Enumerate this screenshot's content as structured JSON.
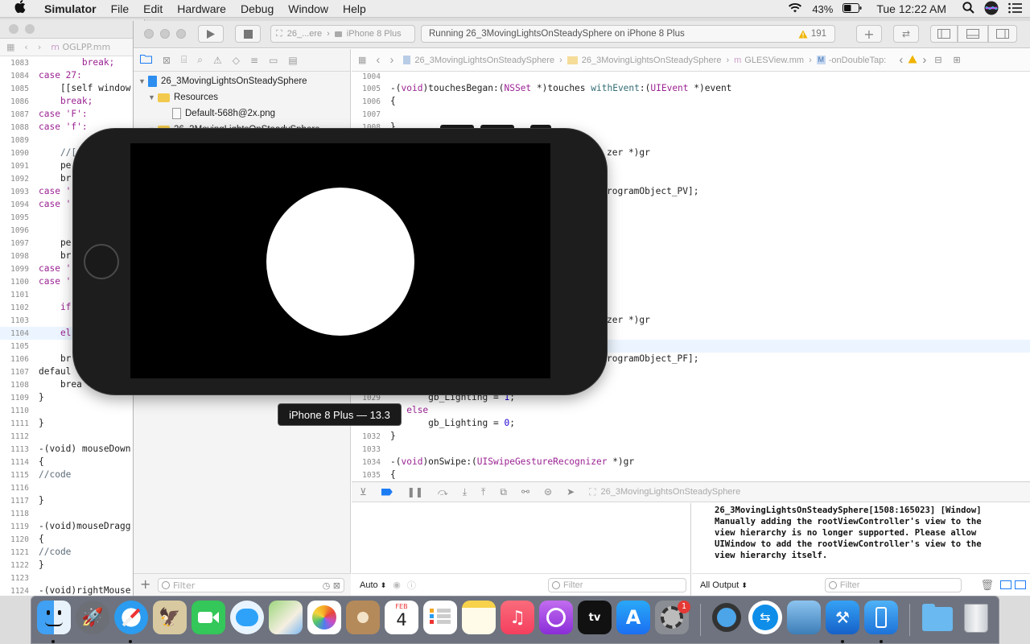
{
  "menubar": {
    "apple": "",
    "items": [
      "Simulator",
      "File",
      "Edit",
      "Hardware",
      "Debug",
      "Window",
      "Help"
    ],
    "battery": "43%",
    "clock": "Tue 12:22 AM"
  },
  "back_window": {
    "tab_title": "OGLPP.mm",
    "lines": [
      {
        "n": "1083",
        "code": "        break;"
      },
      {
        "n": "1084",
        "code": "case 27:"
      },
      {
        "n": "1085",
        "code": "    [[self window"
      },
      {
        "n": "1086",
        "code": "    break;"
      },
      {
        "n": "1087",
        "code": "case 'F':"
      },
      {
        "n": "1088",
        "code": "case 'f':"
      },
      {
        "n": "1089",
        "code": ""
      },
      {
        "n": "1090",
        "code": "    //["
      },
      {
        "n": "1091",
        "code": "    pe"
      },
      {
        "n": "1092",
        "code": "    br"
      },
      {
        "n": "1093",
        "code": "case '"
      },
      {
        "n": "1094",
        "code": "case '"
      },
      {
        "n": "1095",
        "code": ""
      },
      {
        "n": "1096",
        "code": ""
      },
      {
        "n": "1097",
        "code": "    pe"
      },
      {
        "n": "1098",
        "code": "    br"
      },
      {
        "n": "1099",
        "code": "case '"
      },
      {
        "n": "1100",
        "code": "case '"
      },
      {
        "n": "1101",
        "code": ""
      },
      {
        "n": "1102",
        "code": "    if"
      },
      {
        "n": "1103",
        "code": ""
      },
      {
        "n": "1104",
        "code": "    el"
      },
      {
        "n": "1105",
        "code": ""
      },
      {
        "n": "1106",
        "code": "    br"
      },
      {
        "n": "1107",
        "code": "defaul"
      },
      {
        "n": "1108",
        "code": "    brea"
      },
      {
        "n": "1109",
        "code": "}"
      },
      {
        "n": "1110",
        "code": ""
      },
      {
        "n": "1111",
        "code": "}"
      },
      {
        "n": "1112",
        "code": ""
      },
      {
        "n": "1113",
        "code": "-(void) mouseDown"
      },
      {
        "n": "1114",
        "code": "{"
      },
      {
        "n": "1115",
        "code": "//code"
      },
      {
        "n": "1116",
        "code": ""
      },
      {
        "n": "1117",
        "code": "}"
      },
      {
        "n": "1118",
        "code": ""
      },
      {
        "n": "1119",
        "code": "-(void)mouseDragg"
      },
      {
        "n": "1120",
        "code": "{"
      },
      {
        "n": "1121",
        "code": "//code"
      },
      {
        "n": "1122",
        "code": "}"
      },
      {
        "n": "1123",
        "code": ""
      },
      {
        "n": "1124",
        "code": "-(void)rightMouse"
      }
    ]
  },
  "xcode": {
    "scheme": "26_...ere",
    "destination": "iPhone 8 Plus",
    "status": "Running 26_3MovingLightsOnSteadySphere on iPhone 8 Plus",
    "warning_count": "191",
    "navigator": {
      "project": "26_3MovingLightsOnSteadySphere",
      "group_resources": "Resources",
      "file_default": "Default-568h@2x.png",
      "group_partial": "26_3MovingLightsOnSteadySphere",
      "filter_placeholder": "Filter"
    },
    "jumpbar": [
      "26_3MovingLightsOnSteadySphere",
      "26_3MovingLightsOnSteadySphere",
      "GLESView.mm",
      "-onDoubleTap:"
    ],
    "editor": {
      "l1004": "1004",
      "l1005": "1005",
      "c1005a": "-(",
      "c1005b": "void",
      "c1005c": ")touchesBegan:(",
      "c1005d": "NSSet",
      "c1005e": " *)touches ",
      "c1005f": "withEvent",
      "c1005g": ":(",
      "c1005h": "UIEvent",
      "c1005i": " *)event",
      "l1006": "1006",
      "c1006": "{",
      "l1007": "1007",
      "l1008": "1008",
      "c1008": "}",
      "frag1": "zer *)gr",
      "frag2": "rogramObject_PV];",
      "frag3": "zer *)gr",
      "frag4": "rogramObject_PF];",
      "l1029": "1029",
      "c1029a": "gb_Lighting",
      "c1029b": " = ",
      "c1029c": "1",
      "c1029d": ";",
      "l1030": "1030",
      "c1030": "else",
      "l1031": "1031",
      "c1031a": "gb_Lighting",
      "c1031b": " = ",
      "c1031c": "0",
      "c1031d": ";",
      "l1032": "1032",
      "c1032": "}",
      "l1033": "1033",
      "l1034": "1034",
      "c1034a": "-(",
      "c1034b": "void",
      "c1034c": ")onSwipe:(",
      "c1034d": "UISwipeGestureRecognizer",
      "c1034e": " *)gr",
      "l1035": "1035",
      "c1035": "{"
    },
    "debug_target": "26_3MovingLightsOnSteadySphere",
    "console_text": "26_3MovingLightsOnSteadySphere[1508:165023] [Window]\nManually adding the rootViewController's view to the\nview hierarchy is no longer supported. Please allow\nUIWindow to add the rootViewController's view to the\nview hierarchy itself.",
    "auto_label": "Auto",
    "all_output_label": "All Output",
    "filter_placeholder": "Filter"
  },
  "simulator": {
    "tooltip": "iPhone 8 Plus — 13.3"
  },
  "dock": {
    "calendar_month": "FEB",
    "calendar_day": "4",
    "settings_badge": "1",
    "appletv_label": "tv"
  },
  "colors": {
    "accent": "#1c7cf4",
    "keyword": "#9b2393",
    "number": "#1c00cf",
    "string": "#c41a16",
    "warning": "#f4b400"
  }
}
